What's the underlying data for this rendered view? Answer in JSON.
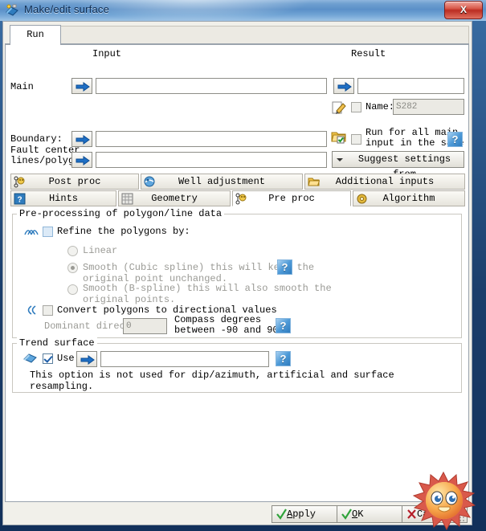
{
  "window": {
    "title": "Make/edit surface",
    "icon": "surface-icon",
    "close_label": "X"
  },
  "outer_tab": {
    "label": "Run"
  },
  "form": {
    "input_header": "Input",
    "result_header": "Result",
    "rows": [
      {
        "label": "Main",
        "value": "",
        "arrow": "arrow-right-icon"
      },
      {
        "label": "Boundary:",
        "value": "",
        "arrow": "arrow-right-icon"
      },
      {
        "label": "Fault center\nlines/polygo",
        "value": "",
        "arrow": "arrow-right-icon"
      }
    ],
    "result": {
      "value": "",
      "arrow": "arrow-right-icon"
    },
    "name": {
      "label": "Name:",
      "value": "S282",
      "checked": false
    },
    "run_all": {
      "label": "Run for all main\ninput in the same",
      "checked": false
    },
    "suggest_button": "Suggest settings from",
    "edit_icon": "pencil-edit-icon",
    "folder_icon": "folder-check-icon",
    "help_icon": "help-question-icon"
  },
  "tabs_row1": [
    {
      "label": "Post proc",
      "icon": "post-proc-icon",
      "active": false
    },
    {
      "label": "Well adjustment",
      "icon": "well-adjustment-icon",
      "active": false
    },
    {
      "label": "Additional inputs",
      "icon": "folder-open-icon",
      "active": false
    }
  ],
  "tabs_row2": [
    {
      "label": "Hints",
      "icon": "hints-help-icon",
      "active": false
    },
    {
      "label": "Geometry",
      "icon": "grid-geometry-icon",
      "active": false
    },
    {
      "label": "Pre proc",
      "icon": "pre-proc-icon",
      "active": true
    },
    {
      "label": "Algorithm",
      "icon": "algorithm-gear-icon",
      "active": false
    }
  ],
  "preproc": {
    "group_title": "Pre-processing of polygon/line data",
    "refine": {
      "label": "Refine the polygons by:",
      "checked": false,
      "icon": "refine-waves-icon"
    },
    "options": [
      {
        "label": "Linear",
        "selected": false
      },
      {
        "label": "Smooth (Cubic spline) this will keep the\noriginal point unchanged.",
        "selected": true
      },
      {
        "label": "Smooth (B-spline) this will also smooth the\noriginal points.",
        "selected": false
      }
    ],
    "convert": {
      "label": "Convert polygons to directional values",
      "checked": false,
      "icon": "convert-waves-icon"
    },
    "dominant": {
      "label": "Dominant directi",
      "value": "0",
      "hint": "Compass degrees\nbetween -90 and 90"
    },
    "help_icon": "help-question-icon"
  },
  "trend": {
    "group_title": "Trend surface",
    "use": {
      "label": "Use",
      "checked": true,
      "icon": "trend-surface-icon"
    },
    "value": "",
    "arrow": "arrow-right-icon",
    "note": "This option is not used for dip/azimuth, artificial and surface\nresampling.",
    "help_icon": "help-question-icon"
  },
  "buttons": {
    "apply": {
      "pre": "",
      "accel": "A",
      "post": "pply",
      "icon": "green-check-icon"
    },
    "ok": {
      "pre": "",
      "accel": "O",
      "post": "K",
      "icon": "green-check-icon"
    },
    "cancel": {
      "label": "Cancel",
      "icon": "red-x-icon"
    }
  },
  "decoration": {
    "sun": "sun-face-watermark"
  },
  "colors": {
    "titlebar": "#6e9fd0",
    "close": "#bb2d22",
    "help_blue": "#2f7cbe",
    "accent_arrow": "#1f6fc4",
    "window_frame": "#12305a"
  }
}
